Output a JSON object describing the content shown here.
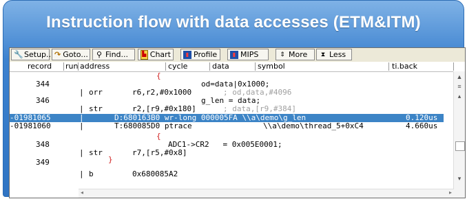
{
  "slide_title": "Instruction flow with data accesses (ETM&ITM)",
  "toolbar": {
    "setup": "Setup...",
    "goto": "Goto...",
    "find": "Find...",
    "chart": "Chart",
    "profile": "Profile",
    "mips": "MIPS",
    "more": "More",
    "less": "Less"
  },
  "columns": {
    "record": "record",
    "run": "run",
    "address": "address",
    "cycle": "cycle",
    "data": "data",
    "symbol": "symbol",
    "ti_back": "ti.back"
  },
  "lines": [
    {
      "brace": "{"
    },
    {
      "record": "344",
      "source": "od=data|0x1000;"
    },
    {
      "mnemonic": "orr",
      "operands": "r6,r2,#0x1000",
      "comment": "; od,data,#4096"
    },
    {
      "record": "346",
      "source": "g_len = data;"
    },
    {
      "mnemonic": "str",
      "operands": "r2,[r9,#0x180]",
      "comment": "; data,[r9,#384]"
    },
    {
      "record": "-01981065",
      "trace": "D:680163B0 wr-long 000005FA \\\\a\\demo\\g_len",
      "ti_back": "0.120us"
    },
    {
      "record": "-01981060",
      "trace": "T:680085D0 ptrace",
      "symbol": "\\\\a\\demo\\thread_5+0xC4",
      "ti_back": "4.660us"
    },
    {
      "brace": "{"
    },
    {
      "record": "348",
      "source": "ADC1->CR2   = 0x005E0001;"
    },
    {
      "mnemonic": "str",
      "operands": "r7,[r5,#0x8]"
    },
    {
      "record": "349",
      "brace": "}"
    },
    {
      "mnemonic": "b",
      "operands": "0x680085A2"
    }
  ]
}
